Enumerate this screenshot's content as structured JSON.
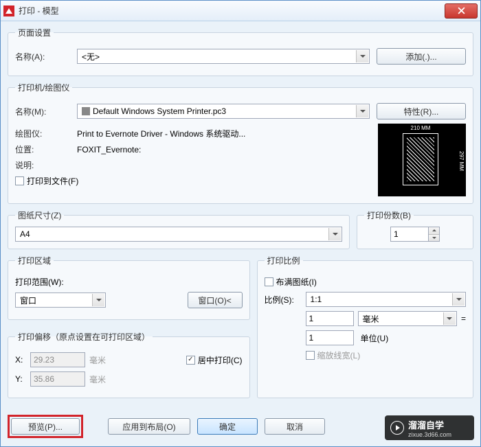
{
  "window": {
    "title": "打印 - 模型"
  },
  "page_setup": {
    "legend": "页面设置",
    "name_label": "名称(A):",
    "name_value": "<无>",
    "add_btn": "添加(.)..."
  },
  "printer": {
    "legend": "打印机/绘图仪",
    "name_label": "名称(M):",
    "name_value": "Default Windows System Printer.pc3",
    "props_btn": "特性(R)...",
    "plotter_label": "绘图仪:",
    "plotter_value": "Print to Evernote Driver - Windows 系统驱动...",
    "where_label": "位置:",
    "where_value": "FOXIT_Evernote:",
    "desc_label": "说明:",
    "tofile_label": "打印到文件(F)",
    "preview_w": "210 MM",
    "preview_h": "297 MM"
  },
  "paper": {
    "legend": "图纸尺寸(Z)",
    "value": "A4"
  },
  "copies": {
    "legend": "打印份数(B)",
    "value": "1"
  },
  "area": {
    "legend": "打印区域",
    "range_label": "打印范围(W):",
    "range_value": "窗口",
    "window_btn": "窗口(O)<"
  },
  "offset": {
    "legend": "打印偏移（原点设置在可打印区域）",
    "x_label": "X:",
    "x_value": "29.23",
    "y_label": "Y:",
    "y_value": "35.86",
    "unit": "毫米",
    "center_label": "居中打印(C)"
  },
  "scale": {
    "legend": "打印比例",
    "fit_label": "布满图纸(I)",
    "scale_label": "比例(S):",
    "scale_value": "1:1",
    "num_value": "1",
    "unit_value": "毫米",
    "equals": "=",
    "den_value": "1",
    "units_label": "单位(U)",
    "lineweights_label": "缩放线宽(L)"
  },
  "footer": {
    "preview": "预览(P)...",
    "apply": "应用到布局(O)",
    "ok": "确定",
    "cancel": "取消"
  },
  "watermark": {
    "brand": "溜溜自学",
    "url": "zixue.3d66.com"
  }
}
